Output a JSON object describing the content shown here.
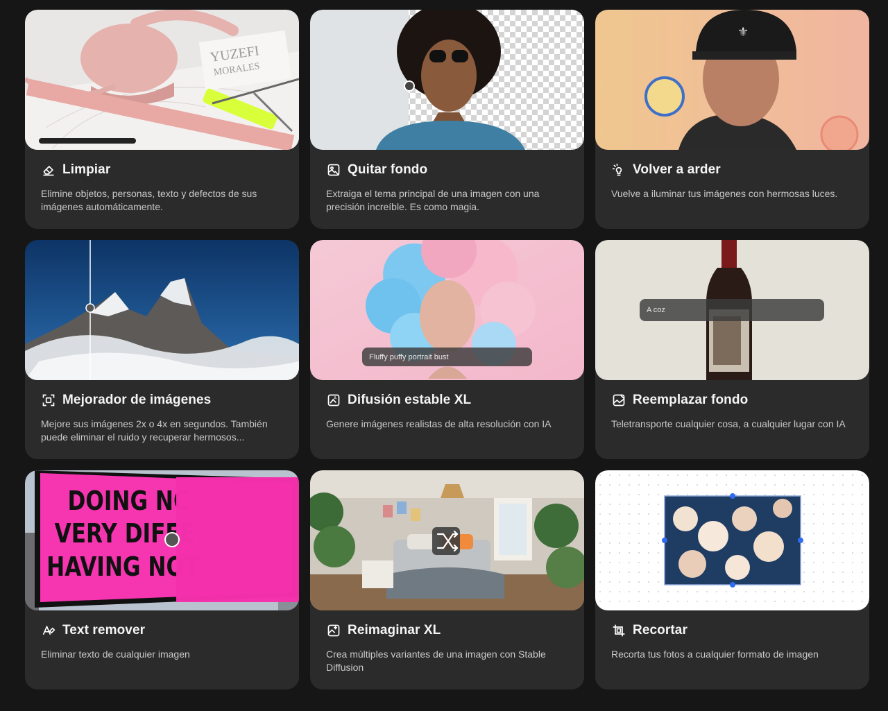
{
  "cards": [
    {
      "title": "Limpiar",
      "icon": "eraser-icon",
      "description": "Elimine objetos, personas, texto y defectos de sus imágenes automáticamente.",
      "thumb_text": "YUZEFI\nMORALES"
    },
    {
      "title": "Quitar fondo",
      "icon": "remove-background-icon",
      "description": "Extraiga el tema principal de una imagen con una precisión increíble. Es como magia."
    },
    {
      "title": "Volver a arder",
      "icon": "relight-icon",
      "description": "Vuelve a iluminar tus imágenes con hermosas luces."
    },
    {
      "title": "Mejorador de imágenes",
      "icon": "upscale-icon",
      "description": "Mejore sus imágenes 2x o 4x en segundos. También puede eliminar el ruido y recuperar hermosos..."
    },
    {
      "title": "Difusión estable XL",
      "icon": "text-to-image-icon",
      "description": "Genere imágenes realistas de alta resolución con IA",
      "prompt_text": "Fluffy puffy portrait bust"
    },
    {
      "title": "Reemplazar fondo",
      "icon": "replace-background-icon",
      "description": "Teletransporte cualquier cosa, a cualquier lugar con IA",
      "prompt_text": "A coz"
    },
    {
      "title": "Text remover",
      "icon": "text-remover-icon",
      "description": "Eliminar texto de cualquier imagen",
      "billboard_lines": [
        "DOING NC",
        "VERY DIFFE",
        "HAVING NOT"
      ]
    },
    {
      "title": "Reimaginar XL",
      "icon": "reimagine-icon",
      "description": "Crea múltiples variantes de una imagen con Stable Diffusion"
    },
    {
      "title": "Recortar",
      "icon": "crop-icon",
      "description": "Recorta tus fotos a cualquier formato de imagen"
    }
  ]
}
